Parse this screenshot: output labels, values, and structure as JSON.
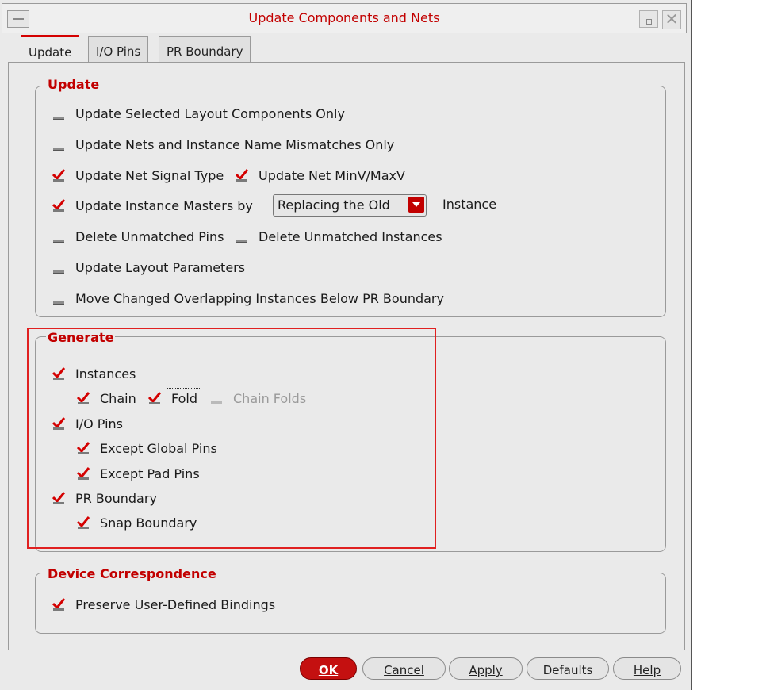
{
  "window": {
    "title": "Update Components and Nets",
    "close_glyph": "✕"
  },
  "tabs": [
    {
      "label": "Update",
      "active": true
    },
    {
      "label": "I/O Pins",
      "active": false
    },
    {
      "label": "PR Boundary",
      "active": false
    }
  ],
  "update_group": {
    "legend": "Update",
    "selected_only": {
      "label": "Update Selected Layout Components Only",
      "checked": false
    },
    "name_mismatch": {
      "label": "Update Nets and Instance Name Mismatches Only",
      "checked": false
    },
    "net_signal_type": {
      "label": "Update Net Signal Type",
      "checked": true
    },
    "net_minmax": {
      "label": "Update Net MinV/MaxV",
      "checked": true
    },
    "instance_masters": {
      "label": "Update Instance Masters by",
      "checked": true
    },
    "instance_masters_combo": {
      "value": "Replacing the Old"
    },
    "instance_masters_suffix": "Instance",
    "delete_pins": {
      "label": "Delete Unmatched Pins",
      "checked": false
    },
    "delete_instances": {
      "label": "Delete Unmatched Instances",
      "checked": false
    },
    "layout_params": {
      "label": "Update Layout Parameters",
      "checked": false
    },
    "move_overlapping": {
      "label": "Move Changed Overlapping Instances Below PR Boundary",
      "checked": false
    }
  },
  "generate_group": {
    "legend": "Generate",
    "instances": {
      "label": "Instances",
      "checked": true
    },
    "chain": {
      "label": "Chain",
      "checked": true
    },
    "fold": {
      "label": "Fold",
      "checked": true
    },
    "chain_folds": {
      "label": "Chain Folds",
      "checked": false,
      "enabled": false
    },
    "io_pins": {
      "label": "I/O Pins",
      "checked": true
    },
    "except_global": {
      "label": "Except Global Pins",
      "checked": true
    },
    "except_pad": {
      "label": "Except Pad Pins",
      "checked": true
    },
    "pr_boundary": {
      "label": "PR Boundary",
      "checked": true
    },
    "snap_boundary": {
      "label": "Snap Boundary",
      "checked": true
    }
  },
  "device_group": {
    "legend": "Device Correspondence",
    "preserve_bindings": {
      "label": "Preserve User-Defined Bindings",
      "checked": true
    }
  },
  "buttons": {
    "ok": "OK",
    "cancel": "Cancel",
    "apply": "Apply",
    "defaults": "Defaults",
    "help": "Help"
  },
  "colors": {
    "accent": "#c20000",
    "highlight_box": "#e02020",
    "background": "#eaeaea"
  }
}
